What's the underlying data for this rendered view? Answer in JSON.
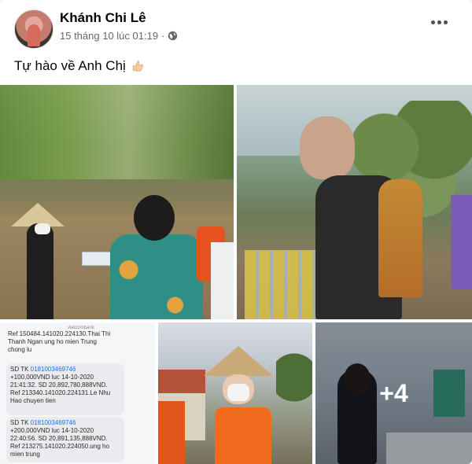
{
  "post": {
    "author": "Khánh Chi Lê",
    "timestamp": "15 tháng 10 lúc 01:19",
    "privacy_separator": "·",
    "status_text": "Tự hào về Anh Chị",
    "status_emoji_icon": "thumbs-up-icon",
    "more_options_icon": "more-horizontal-icon"
  },
  "gallery": {
    "more_count": "+4",
    "receipt": {
      "bank": "vietcombank",
      "line1": "Ref 150484.141020.224130.Thai Thi",
      "line2": "Thanh Ngan ung ho mien Trung",
      "line3": "chong lu",
      "b1_prefix": "SD TK ",
      "b1_account": "0181003469746",
      "b1_line2": "+100,000VND luc 14-10-2020",
      "b1_line3": "21:41:32. SD 20,892,780,888VND.",
      "b1_line4": "Ref 213340.141020.224131.Le Nhu",
      "b1_line5": "Hao chuyen tien",
      "b2_prefix": "SD TK ",
      "b2_account": "0181003469746",
      "b2_line2": "+200,000VND luc 14-10-2020",
      "b2_line3": "22:40:56. SD 20,891,135,888VND.",
      "b2_line4": "Ref 213275.141020.224050.ung ho",
      "b2_line5": "mien trung"
    }
  },
  "colors": {
    "link": "#1a73e8",
    "name": "#050505",
    "meta": "#65676b"
  }
}
